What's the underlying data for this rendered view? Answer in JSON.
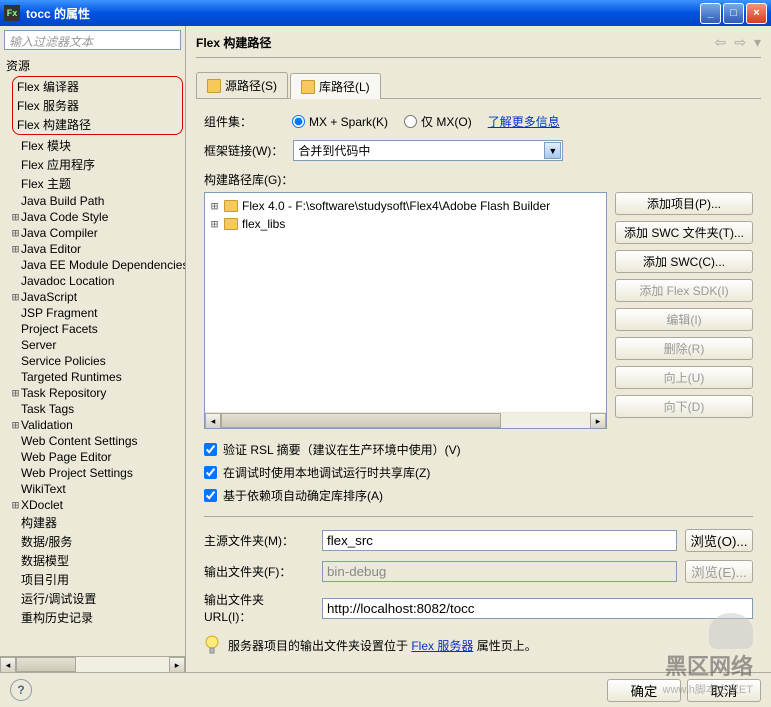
{
  "window": {
    "title": "tocc 的属性"
  },
  "sidebar": {
    "filter_placeholder": "输入过滤器文本",
    "root": "资源",
    "highlighted": [
      "Flex 编译器",
      "Flex 服务器",
      "Flex 构建路径"
    ],
    "items": [
      "Flex 模块",
      "Flex 应用程序",
      "Flex 主题",
      "Java Build Path",
      "Java Code Style",
      "Java Compiler",
      "Java Editor",
      "Java EE Module Dependencies",
      "Javadoc Location",
      "JavaScript",
      "JSP Fragment",
      "Project Facets",
      "Server",
      "Service Policies",
      "Targeted Runtimes",
      "Task Repository",
      "Task Tags",
      "Validation",
      "Web Content Settings",
      "Web Page Editor",
      "Web Project Settings",
      "WikiText",
      "XDoclet",
      "构建器",
      "数据/服务",
      "数据模型",
      "项目引用",
      "运行/调试设置",
      "重构历史记录"
    ],
    "expandable": [
      "Java Code Style",
      "Java Compiler",
      "Java Editor",
      "JavaScript",
      "Task Repository",
      "Validation",
      "XDoclet"
    ]
  },
  "main": {
    "title": "Flex 构建路径",
    "tabs": {
      "source": "源路径(S)",
      "lib": "库路径(L)"
    },
    "componentset": {
      "label": "组件集：",
      "opt1": "MX + Spark(K)",
      "opt2": "仅 MX(O)",
      "link": "了解更多信息"
    },
    "framework": {
      "label": "框架链接(W)：",
      "value": "合并到代码中"
    },
    "libpath": {
      "label": "构建路径库(G)：",
      "items": [
        "Flex 4.0 - F:\\software\\studysoft\\Flex4\\Adobe Flash Builder",
        "flex_libs"
      ]
    },
    "buttons": {
      "add_project": "添加项目(P)...",
      "add_swc_folder": "添加 SWC 文件夹(T)...",
      "add_swc": "添加 SWC(C)...",
      "add_flex_sdk": "添加 Flex SDK(I)",
      "edit": "编辑(I)",
      "remove": "删除(R)",
      "up": "向上(U)",
      "down": "向下(D)"
    },
    "checks": {
      "c1": "验证 RSL 摘要（建议在生产环境中使用）(V)",
      "c2": "在调试时使用本地调试运行时共享库(Z)",
      "c3": "基于依赖项自动确定库排序(A)"
    },
    "paths": {
      "main_src_label": "主源文件夹(M)：",
      "main_src_value": "flex_src",
      "out_folder_label": "输出文件夹(F)：",
      "out_folder_value": "bin-debug",
      "out_url_label": "输出文件夹 URL(I)：",
      "out_url_value": "http://localhost:8082/tocc",
      "browse": "浏览(O)...",
      "browse2": "浏览(E)..."
    },
    "info": {
      "prefix": "服务器项目的输出文件夹设置位于 ",
      "link": "Flex 服务器",
      "suffix": " 属性页上。"
    }
  },
  "footer": {
    "ok": "确定",
    "cancel": "取消"
  },
  "watermark": {
    "big": "黑区网络",
    "sub": "www.h脚本之家ET"
  }
}
